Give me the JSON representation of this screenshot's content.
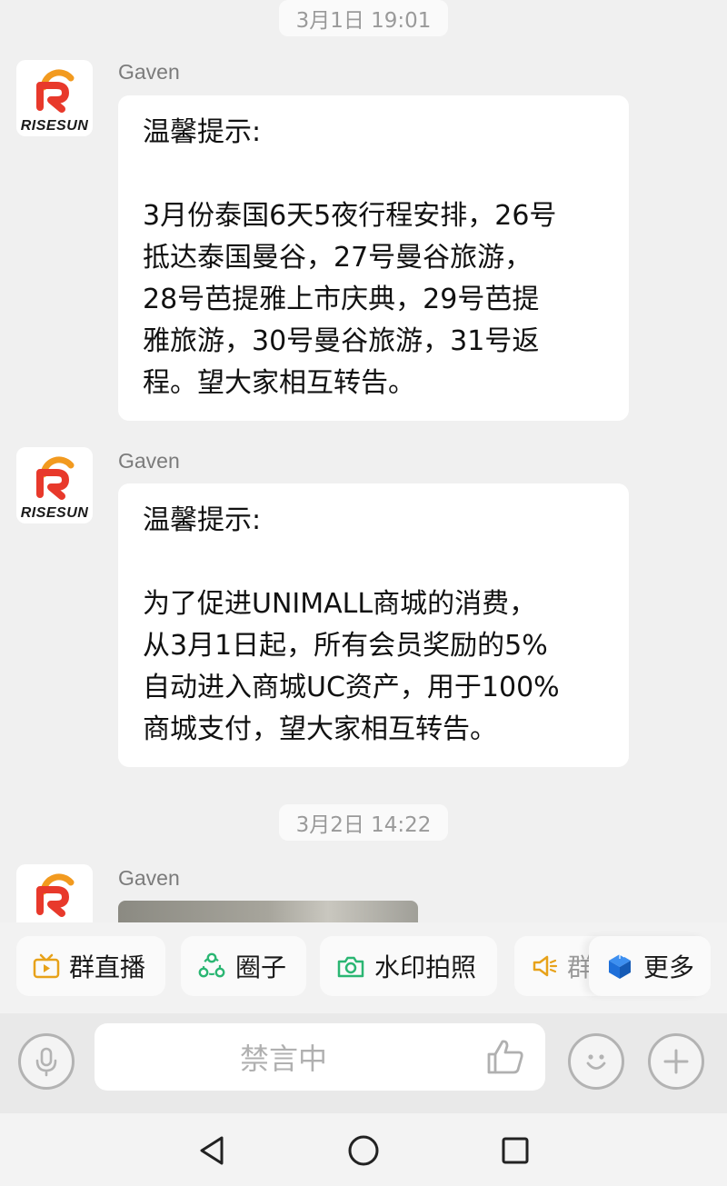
{
  "colors": {
    "chat_background": "#f0f0f0",
    "bubble": "#ffffff",
    "logo_red": "#e8392b",
    "logo_orange": "#f29a1f",
    "chip_icon_orange": "#e7a21a",
    "chip_icon_green": "#2bb673",
    "chip_icon_blue": "#1e6fd9"
  },
  "messages_area": {
    "timestamps": [
      "3月1日 19:01",
      "3月2日 14:22"
    ],
    "messages": [
      {
        "sender": "Gaven",
        "avatar_brand": "RISESUN",
        "head": "温馨提示:",
        "lines": [
          "3月份泰国6天5夜行程安排，26号",
          "抵达泰国曼谷，27号曼谷旅游，",
          "28号芭提雅上市庆典，29号芭提",
          "雅旅游，30号曼谷旅游，31号返",
          "程。望大家相互转告。"
        ]
      },
      {
        "sender": "Gaven",
        "avatar_brand": "RISESUN",
        "head": "温馨提示:",
        "lines": [
          "为了促进UNIMALL商城的消费，",
          "从3月1日起，所有会员奖励的5%",
          "自动进入商城UC资产，用于100%",
          "商城支付，望大家相互转告。"
        ]
      },
      {
        "sender": "Gaven",
        "avatar_brand": "RISESUN",
        "content": "image"
      }
    ]
  },
  "quick_actions": [
    {
      "label": "群直播",
      "icon": "tv-play-icon"
    },
    {
      "label": "圈子",
      "icon": "circle-nodes-icon"
    },
    {
      "label": "水印拍照",
      "icon": "camera-icon"
    },
    {
      "label": "群",
      "icon": "speaker-icon"
    },
    {
      "label": "更多",
      "icon": "cube-icon"
    }
  ],
  "input_bar": {
    "placeholder": "禁言中",
    "left_icon": "microphone-icon",
    "like_icon": "thumbs-up-icon",
    "emoji_icon": "smile-icon",
    "add_icon": "plus-icon"
  },
  "system_nav": [
    "back-icon",
    "home-icon",
    "recents-icon"
  ]
}
